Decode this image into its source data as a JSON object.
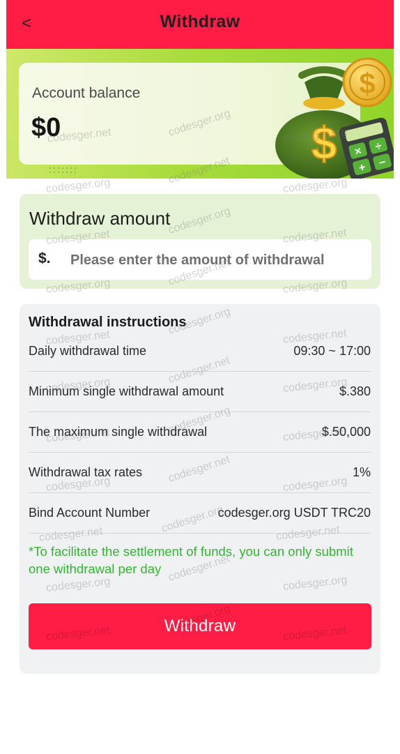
{
  "header": {
    "back_glyph": "<",
    "title": "Withdraw"
  },
  "balance": {
    "label": "Account balance",
    "value": "$0"
  },
  "amount": {
    "title": "Withdraw amount",
    "currency": "$.",
    "placeholder": "Please enter the amount of withdrawal",
    "value": ""
  },
  "instructions": {
    "title": "Withdrawal instructions",
    "rows": [
      {
        "label": "Daily withdrawal time",
        "value": "09:30 ~ 17:00"
      },
      {
        "label": "Minimum single withdrawal amount",
        "value": "$.380"
      },
      {
        "label": "The maximum single withdrawal",
        "value": "$.50,000"
      },
      {
        "label": "Withdrawal tax rates",
        "value": "1%"
      },
      {
        "label": "Bind Account Number",
        "value": "codesger.org USDT TRC20"
      }
    ],
    "notice": "*To facilitate the settlement of funds, you can only submit one withdrawal per day"
  },
  "button": {
    "label": "Withdraw"
  },
  "watermarks": [
    "codesger.net",
    "codesger.org"
  ],
  "colors": {
    "primary": "#ff1d45",
    "hero_green": "#a9dc3c",
    "notice_green": "#2fb82f",
    "card_gray": "#f0f1f3",
    "amount_card": "#e6f2d6"
  },
  "icons": {
    "hero": "money-bag-coin-calculator-icon"
  }
}
